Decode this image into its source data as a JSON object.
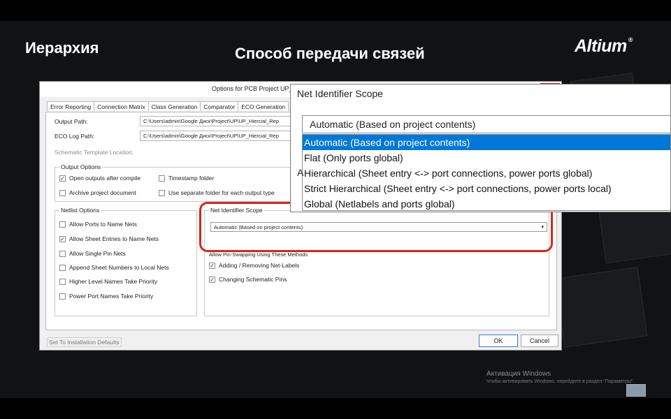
{
  "slide": {
    "left_title": "Иерархия",
    "center_title": "Способ передачи связей",
    "brand": "Altium",
    "brand_mark": "®"
  },
  "dialog": {
    "title": "Options for PCB Project UP_",
    "close_glyph": "✕",
    "tabs": [
      "Error Reporting",
      "Connection Matrix",
      "Class Generation",
      "Comparator",
      "ECO Generation"
    ],
    "output_path_label": "Output Path:",
    "output_path_value": "C:\\Users\\admin\\Google Диск\\Project\\UP\\UP_Hiercial_Rep",
    "eco_log_label": "ECO Log Path:",
    "eco_log_value": "C:\\Users\\admin\\Google Диск\\Project\\UP\\UP_Hiercial_Rep",
    "schematic_template_label": "Schematic Template Location:",
    "output_options": {
      "label": "Output Options",
      "items": [
        {
          "label": "Open outputs after compile",
          "checked": true
        },
        {
          "label": "Timestamp folder",
          "checked": false
        },
        {
          "label": "Archive project document",
          "checked": false
        },
        {
          "label": "Use separate folder for each output type",
          "checked": false
        }
      ]
    },
    "netlist_options": {
      "label": "Netlist Options",
      "items": [
        {
          "label": "Allow Ports to Name Nets",
          "checked": false
        },
        {
          "label": "Allow Sheet Entries to Name Nets",
          "checked": true
        },
        {
          "label": "Allow Single Pin Nets",
          "checked": false
        },
        {
          "label": "Append Sheet Numbers to Local Nets",
          "checked": false
        },
        {
          "label": "Higher Level Names Take Priority",
          "checked": false
        },
        {
          "label": "Power Port Names Take Priority",
          "checked": false
        }
      ]
    },
    "net_identifier": {
      "label": "Net Identifier Scope",
      "value": "Automatic (Based on project contents)"
    },
    "pin_swapping": {
      "label": "Allow Pin-Swapping Using These Methods",
      "items": [
        {
          "label": "Adding / Removing Net-Labels",
          "checked": true
        },
        {
          "label": "Changing Schematic Pins",
          "checked": true
        }
      ]
    },
    "set_defaults": "Set To Installation Defaults",
    "ok": "OK",
    "cancel": "Cancel"
  },
  "zoom": {
    "title": "Net Identifier Scope",
    "current": "Automatic (Based on project contents)",
    "options": [
      "Automatic (Based on project contents)",
      "Flat (Only ports global)",
      "Hierarchical (Sheet entry <-> port connections, power ports global)",
      "Strict Hierarchical (Sheet entry <-> port connections, power ports local)",
      "Global (Netlabels and ports global)"
    ],
    "selected_index": 0,
    "clipped_letter": "A"
  },
  "windows_activation": {
    "title": "Активация Windows",
    "subtitle": "Чтобы активировать Windows, перейдите в раздел \"Параметры\"."
  },
  "colors": {
    "highlight": "#d62818",
    "selection": "#0078d7",
    "close": "#c42b1c"
  }
}
